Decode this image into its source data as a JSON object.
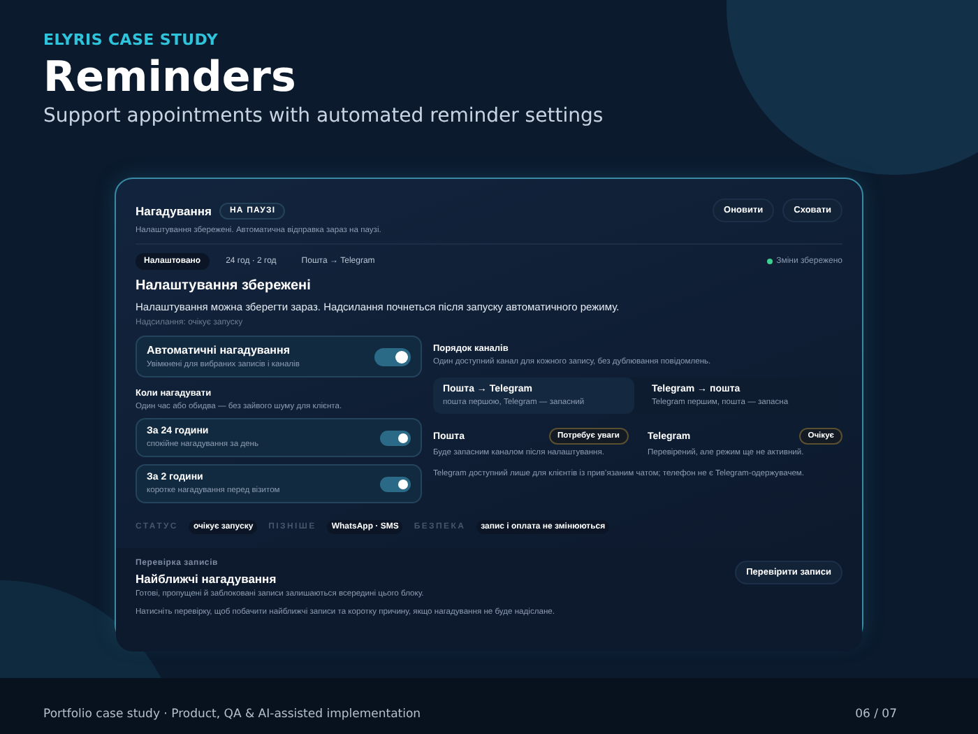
{
  "kicker": "ELYRIS CASE STUDY",
  "title": "Reminders",
  "subtitle": "Support appointments with automated reminder settings",
  "panel": {
    "title": "Нагадування",
    "badge": "НА ПАУЗІ",
    "subtitle": "Налаштування збережені. Автоматична відправка зараз на паузі.",
    "buttons": [
      "Оновити",
      "Сховати"
    ],
    "chips": [
      {
        "label": "Налаштовано",
        "selected": true
      },
      {
        "label": "24 год · 2 год",
        "selected": false
      },
      {
        "label": "Пошта → Telegram",
        "selected": false
      }
    ],
    "saved": "Зміни збережено",
    "heading": "Налаштування збережені",
    "description": "Налаштування можна зберегти зараз. Надсилання почнеться після запуску автоматичного режиму.",
    "note": "Надсилання: очікує запуску",
    "auto": {
      "title": "Автоматичні нагадування",
      "hint": "Увімкнені для вибраних записів і каналів",
      "on": true
    },
    "when": {
      "title": "Коли нагадувати",
      "hint": "Один час або обидва — без зайвого шуму для клієнта."
    },
    "timings": [
      {
        "title": "За 24 години",
        "hint": "спокійне нагадування за день",
        "on": true
      },
      {
        "title": "За 2 години",
        "hint": "коротке нагадування перед візитом",
        "on": true
      }
    ],
    "order": {
      "title": "Порядок каналів",
      "hint": "Один доступний канал для кожного запису, без дублювання повідомлень.",
      "options": [
        {
          "title": "Пошта → Telegram",
          "hint": "пошта першою, Telegram — запасний",
          "selected": true
        },
        {
          "title": "Telegram → пошта",
          "hint": "Telegram першим, пошта — запасна",
          "selected": false
        }
      ]
    },
    "channels": [
      {
        "name": "Пошта",
        "status": "Потребує уваги",
        "hint": "Буде запасним каналом після налаштування."
      },
      {
        "name": "Telegram",
        "status": "Очікує",
        "hint": "Перевірений, але режим ще не активний."
      }
    ],
    "channel_note": "Telegram доступний лише для клієнтів із прив’язаним чатом; телефон не є Telegram-одержувачем.",
    "facts": [
      {
        "label": "СТАТУС",
        "value": "очікує запуску"
      },
      {
        "label": "ПІЗНІШЕ",
        "value": "WhatsApp · SMS"
      },
      {
        "label": "БЕЗПЕКА",
        "value": "запис і оплата не змінюються"
      }
    ],
    "check": {
      "kicker": "Перевірка записів",
      "title": "Найближчі нагадування",
      "hint": "Готові, пропущені й заблоковані записи залишаються всередині цього блоку.",
      "button": "Перевірити записи",
      "note": "Натисніть перевірку, щоб побачити найближчі записи та коротку причину, якщо нагадування не буде надіслане."
    }
  },
  "footer": {
    "left": "Portfolio case study · Product, QA & AI-assisted implementation",
    "right": "06 / 07"
  }
}
